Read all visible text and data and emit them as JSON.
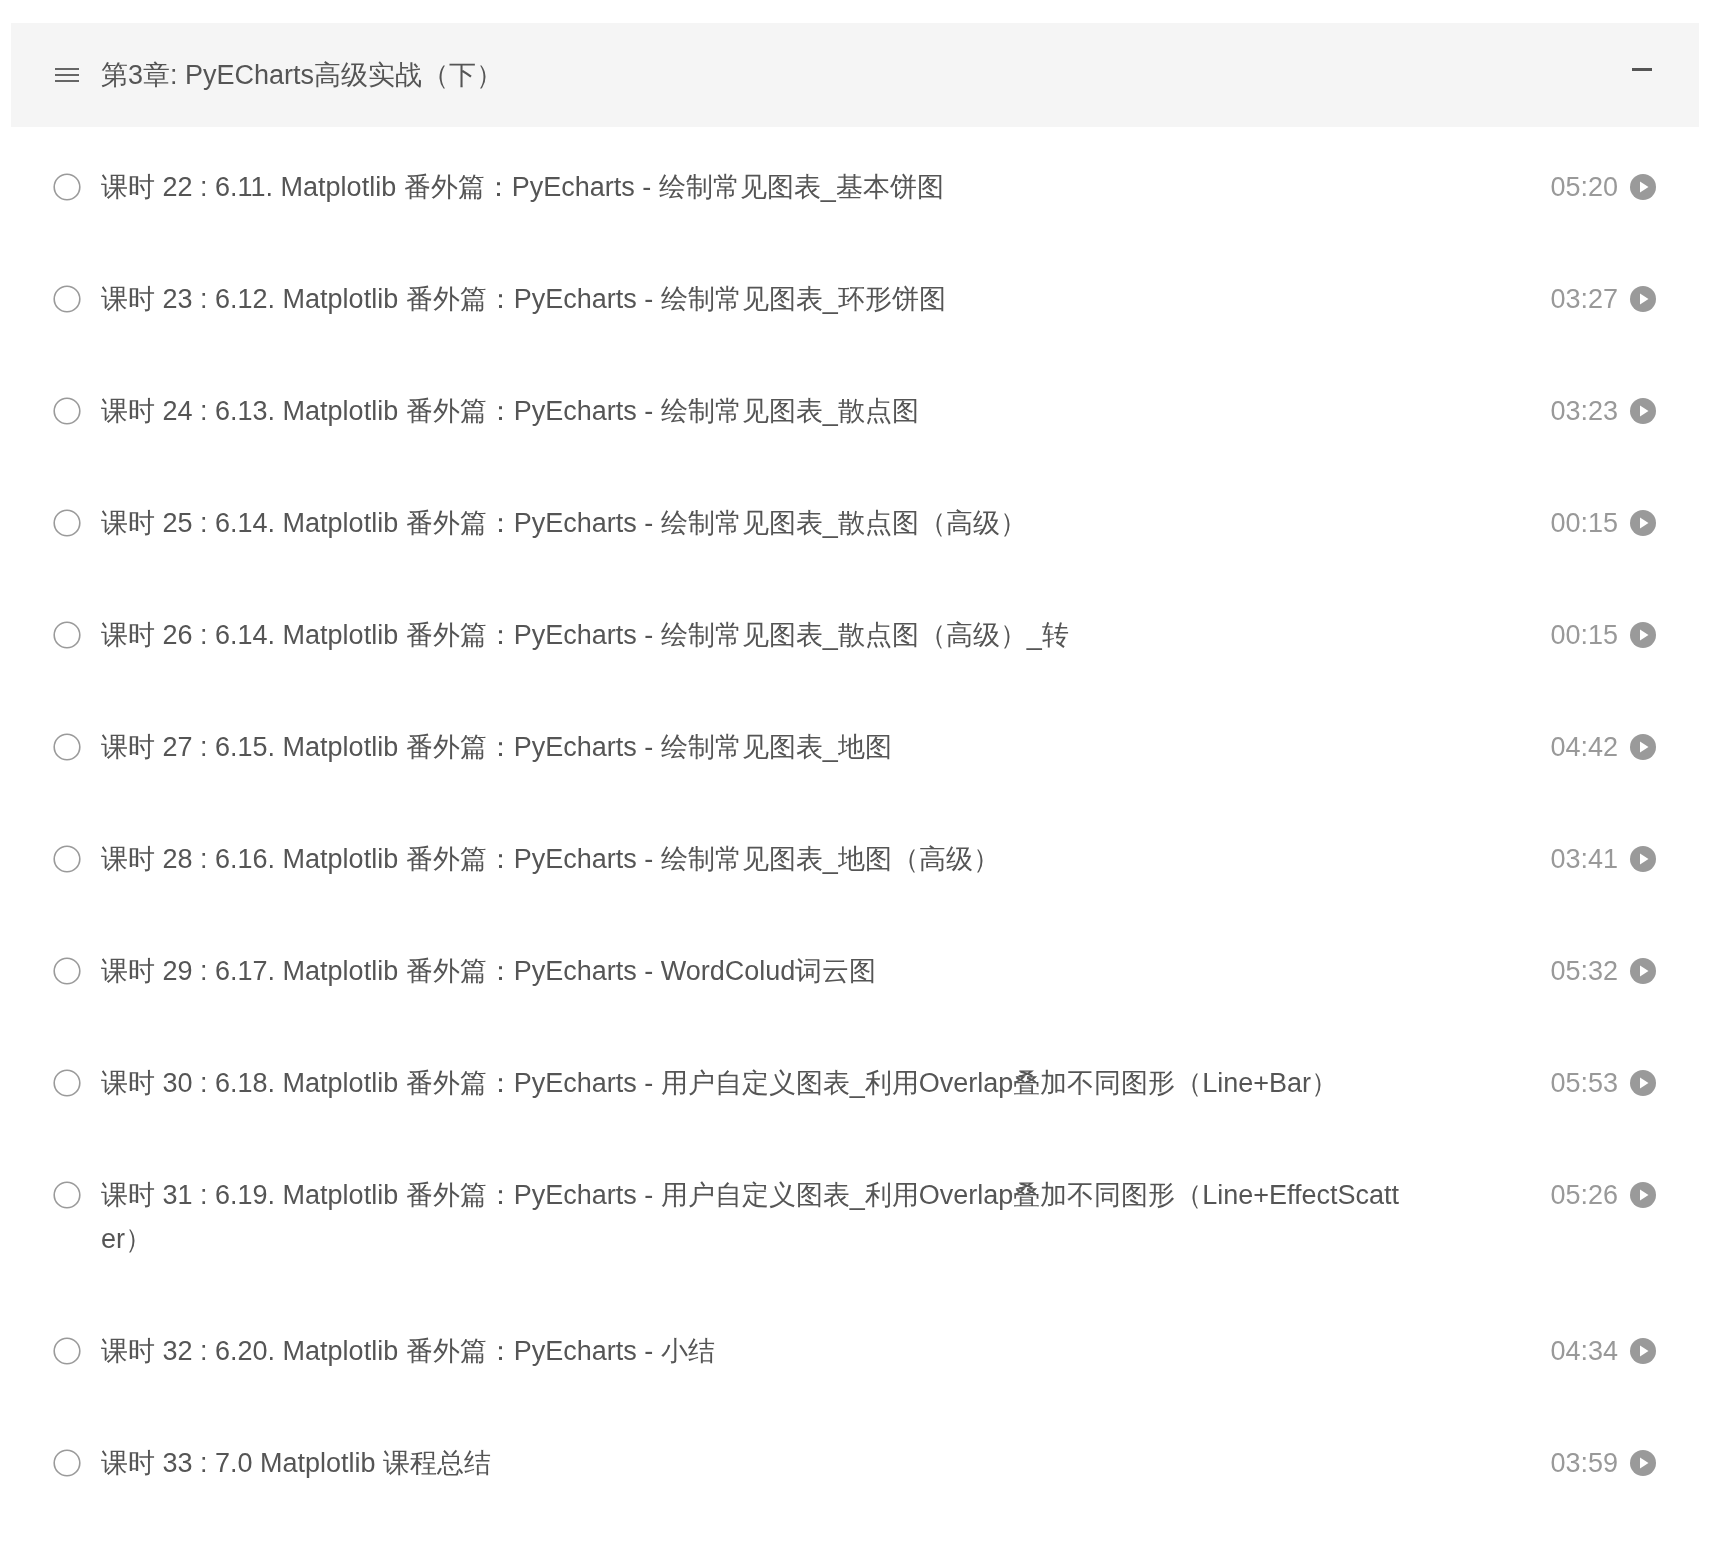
{
  "chapter": {
    "title": "第3章: PyECharts高级实战（下）",
    "expanded": true
  },
  "lessons": [
    {
      "title": "课时 22 : 6.11. Matplotlib 番外篇：PyEcharts - 绘制常见图表_基本饼图",
      "duration": "05:20",
      "watched": false
    },
    {
      "title": "课时 23 : 6.12. Matplotlib 番外篇：PyEcharts - 绘制常见图表_环形饼图",
      "duration": "03:27",
      "watched": false
    },
    {
      "title": "课时 24 : 6.13. Matplotlib 番外篇：PyEcharts - 绘制常见图表_散点图",
      "duration": "03:23",
      "watched": false
    },
    {
      "title": "课时 25 : 6.14. Matplotlib 番外篇：PyEcharts - 绘制常见图表_散点图（高级）",
      "duration": "00:15",
      "watched": false
    },
    {
      "title": "课时 26 : 6.14. Matplotlib 番外篇：PyEcharts - 绘制常见图表_散点图（高级）_转",
      "duration": "00:15",
      "watched": false
    },
    {
      "title": "课时 27 : 6.15. Matplotlib 番外篇：PyEcharts - 绘制常见图表_地图",
      "duration": "04:42",
      "watched": false
    },
    {
      "title": "课时 28 : 6.16. Matplotlib 番外篇：PyEcharts - 绘制常见图表_地图（高级）",
      "duration": "03:41",
      "watched": false
    },
    {
      "title": "课时 29 : 6.17. Matplotlib 番外篇：PyEcharts - WordColud词云图",
      "duration": "05:32",
      "watched": false
    },
    {
      "title": "课时 30 : 6.18. Matplotlib 番外篇：PyEcharts - 用户自定义图表_利用Overlap叠加不同图形（Line+Bar）",
      "duration": "05:53",
      "watched": false
    },
    {
      "title": "课时 31 : 6.19. Matplotlib 番外篇：PyEcharts - 用户自定义图表_利用Overlap叠加不同图形（Line+EffectScatter）",
      "duration": "05:26",
      "watched": false
    },
    {
      "title": "课时 32 : 6.20. Matplotlib 番外篇：PyEcharts - 小结",
      "duration": "04:34",
      "watched": false
    },
    {
      "title": "课时 33 : 7.0 Matplotlib 课程总结",
      "duration": "03:59",
      "watched": false
    }
  ]
}
